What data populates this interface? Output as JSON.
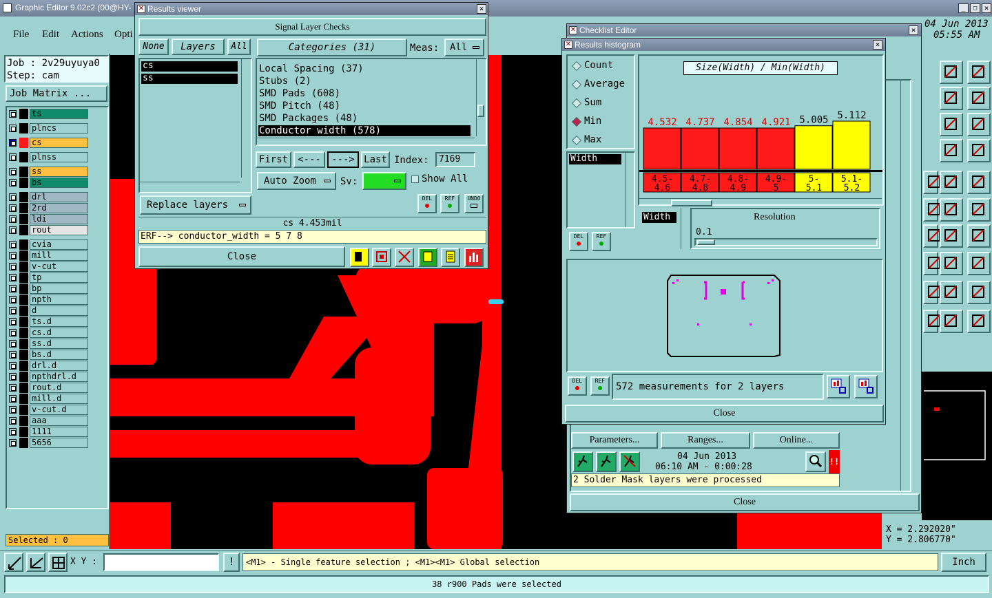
{
  "main": {
    "title": "Graphic Editor 9.02c2 (00@HY-",
    "menu": [
      "File",
      "Edit",
      "Actions",
      "Opti"
    ],
    "job_label": "Job : 2v29uyuya0",
    "step_label": "Step: cam",
    "job_matrix": "Job Matrix ...",
    "selected": "Selected : 0",
    "xy_label": "X Y :",
    "xy_value": "",
    "hint": "<M1> - Single feature selection ; <M1><M1> Global selection",
    "units": "Inch",
    "status": "38 r900 Pads were selected",
    "date": "04 Jun 2013",
    "time": "05:55 AM",
    "coord_x": "X  = 2.292020\"",
    "coord_y": "Y  = 2.806770\""
  },
  "layers": [
    {
      "name": "ts",
      "color": "#0f8a6a"
    },
    {
      "name": "plncs",
      "color": "#9ed2d0"
    },
    {
      "name": "cs",
      "color": "#ffbf40",
      "swatch": "#ff1a1a",
      "active": true
    },
    {
      "name": "plnss",
      "color": "#9ed2d0"
    },
    {
      "name": "ss",
      "color": "#ffbf40"
    },
    {
      "name": "bs",
      "color": "#0f8a6a"
    },
    {
      "name": "drl",
      "color": "#9fb8c4"
    },
    {
      "name": "2rd",
      "color": "#9fb8c4"
    },
    {
      "name": "ldi",
      "color": "#9fb8c4"
    },
    {
      "name": "rout",
      "color": "#e4e4e4"
    },
    {
      "name": "cvia",
      "color": "#9ed2d0"
    },
    {
      "name": "mill",
      "color": "#9ed2d0"
    },
    {
      "name": "v-cut",
      "color": "#9ed2d0"
    },
    {
      "name": "tp",
      "color": "#9ed2d0"
    },
    {
      "name": "bp",
      "color": "#9ed2d0"
    },
    {
      "name": "npth",
      "color": "#9ed2d0"
    },
    {
      "name": "d",
      "color": "#9ed2d0"
    },
    {
      "name": "ts.d",
      "color": "#9ed2d0"
    },
    {
      "name": "cs.d",
      "color": "#9ed2d0"
    },
    {
      "name": "ss.d",
      "color": "#9ed2d0"
    },
    {
      "name": "bs.d",
      "color": "#9ed2d0"
    },
    {
      "name": "drl.d",
      "color": "#9ed2d0"
    },
    {
      "name": "npthdrl.d",
      "color": "#9ed2d0"
    },
    {
      "name": "rout.d",
      "color": "#9ed2d0"
    },
    {
      "name": "mill.d",
      "color": "#9ed2d0"
    },
    {
      "name": "v-cut.d",
      "color": "#9ed2d0"
    },
    {
      "name": "aaa",
      "color": "#9ed2d0"
    },
    {
      "name": "1111",
      "color": "#9ed2d0"
    },
    {
      "name": "5656",
      "color": "#9ed2d0"
    }
  ],
  "results_viewer": {
    "title": "Results viewer",
    "header": "Signal Layer Checks",
    "none_btn": "None",
    "layers_btn": "Layers",
    "all_btn": "All",
    "categories_btn": "Categories (31)",
    "meas_label": "Meas:",
    "meas_value": "All",
    "layer_items": [
      "cs",
      "ss"
    ],
    "categories": [
      "Local Spacing (37)",
      "Stubs (2)",
      "SMD Pads (608)",
      "SMD Pitch (48)",
      "SMD Packages (48)",
      "Conductor width (578)"
    ],
    "first": "First",
    "prev": "<---",
    "next": "--->",
    "last": "Last",
    "index_label": "Index:",
    "index_value": "7169",
    "auto_zoom": "Auto Zoom",
    "sv_label": "Sv:",
    "show_all": "Show All",
    "replace_layers": "Replace layers",
    "del": "DEL",
    "ref": "REF",
    "undo": "UNDO",
    "measurement": "cs 4.453mil",
    "erf": "ERF--> conductor_width = 5 7 8",
    "close": "Close"
  },
  "checklist_editor": {
    "title": "Checklist Editor",
    "parameters": "Parameters...",
    "ranges": "Ranges...",
    "online": "Online...",
    "run_date": "04 Jun 2013",
    "run_time": "06:10 AM - 0:00:28",
    "message": "2 Solder Mask layers were processed",
    "close": "Close"
  },
  "histogram": {
    "title": "Results histogram",
    "options": [
      "Count",
      "Average",
      "Sum",
      "Min",
      "Max"
    ],
    "selected_option": "Min",
    "attr_item": "Width",
    "metric_title": "Size(Width) / Min(Width)",
    "resolution_label": "Resolution",
    "resolution_field": "Width",
    "resolution_value": "0.1",
    "summary": "572 measurements for 2 layers",
    "close": "Close",
    "colors": {
      "red": "#ff1a1a",
      "yellow": "#ffff00"
    }
  },
  "chart_data": {
    "type": "bar",
    "title": "Size(Width) / Min(Width)",
    "categories": [
      "4.5-4.6",
      "4.7-4.8",
      "4.8-4.9",
      "4.9-5",
      "5-5.1",
      "5.1-5.2"
    ],
    "values": [
      4.532,
      4.737,
      4.854,
      4.921,
      5.005,
      5.112
    ],
    "value_labels": [
      "4.532",
      "4.737",
      "4.854",
      "4.921",
      "5.005",
      "5.112"
    ],
    "bar_colors": [
      "#ff1a1a",
      "#ff1a1a",
      "#ff1a1a",
      "#ff1a1a",
      "#ffff00",
      "#ffff00"
    ]
  }
}
